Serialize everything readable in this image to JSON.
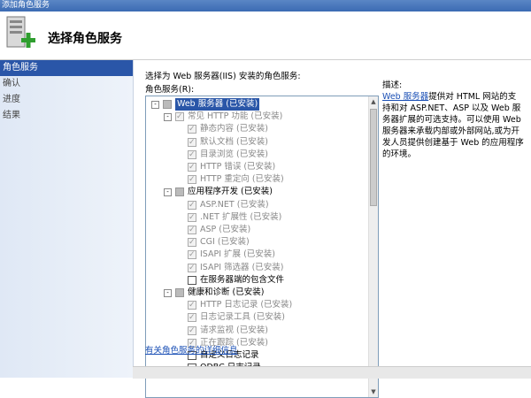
{
  "window": {
    "title": "添加角色服务"
  },
  "header": {
    "title": "选择角色服务"
  },
  "nav": {
    "items": [
      {
        "label": "角色服务",
        "active": true
      },
      {
        "label": "确认"
      },
      {
        "label": "进度"
      },
      {
        "label": "结果"
      }
    ]
  },
  "main": {
    "instruction": "选择为 Web 服务器(IIS) 安装的角色服务:",
    "list_label": "角色服务(R):",
    "more_link": "有关角色服务的详细信息",
    "description": {
      "heading": "描述:",
      "link": "Web 服务器",
      "text": "提供对 HTML 网站的支持和对 ASP.NET、ASP 以及 Web 服务器扩展的可选支持。可以使用 Web 服务器来承载内部或外部网站,或为开发人员提供创建基于 Web 的应用程序的环境。"
    },
    "tree": [
      {
        "label": "Web 服务器   (已安装)",
        "level": 0,
        "expander": "-",
        "state": "partial",
        "selected": true
      },
      {
        "label": "常见 HTTP 功能   (已安装)",
        "level": 1,
        "expander": "-",
        "state": "on"
      },
      {
        "label": "静态内容   (已安装)",
        "level": 2,
        "state": "on"
      },
      {
        "label": "默认文档   (已安装)",
        "level": 2,
        "state": "on"
      },
      {
        "label": "目录浏览   (已安装)",
        "level": 2,
        "state": "on"
      },
      {
        "label": "HTTP 错误   (已安装)",
        "level": 2,
        "state": "on"
      },
      {
        "label": "HTTP 重定向   (已安装)",
        "level": 2,
        "state": "on"
      },
      {
        "label": "应用程序开发   (已安装)",
        "level": 1,
        "expander": "-",
        "state": "partial",
        "bold": true
      },
      {
        "label": "ASP.NET   (已安装)",
        "level": 2,
        "state": "on"
      },
      {
        "label": ".NET 扩展性   (已安装)",
        "level": 2,
        "state": "on"
      },
      {
        "label": "ASP   (已安装)",
        "level": 2,
        "state": "on"
      },
      {
        "label": "CGI   (已安装)",
        "level": 2,
        "state": "on"
      },
      {
        "label": "ISAPI 扩展   (已安装)",
        "level": 2,
        "state": "on"
      },
      {
        "label": "ISAPI 筛选器   (已安装)",
        "level": 2,
        "state": "on"
      },
      {
        "label": "在服务器端的包含文件",
        "level": 2,
        "state": "empty",
        "bold": true
      },
      {
        "label": "健康和诊断   (已安装)",
        "level": 1,
        "expander": "-",
        "state": "partial",
        "bold": true
      },
      {
        "label": "HTTP 日志记录   (已安装)",
        "level": 2,
        "state": "on"
      },
      {
        "label": "日志记录工具   (已安装)",
        "level": 2,
        "state": "on"
      },
      {
        "label": "请求监视   (已安装)",
        "level": 2,
        "state": "on"
      },
      {
        "label": "正在跟踪   (已安装)",
        "level": 2,
        "state": "on"
      },
      {
        "label": "自定义日志记录",
        "level": 2,
        "state": "empty",
        "bold": true
      },
      {
        "label": "ODBC 日志记录",
        "level": 2,
        "state": "empty",
        "bold": true
      }
    ]
  },
  "colors": {
    "accent": "#2a56a8",
    "link": "#1a4fb5"
  }
}
